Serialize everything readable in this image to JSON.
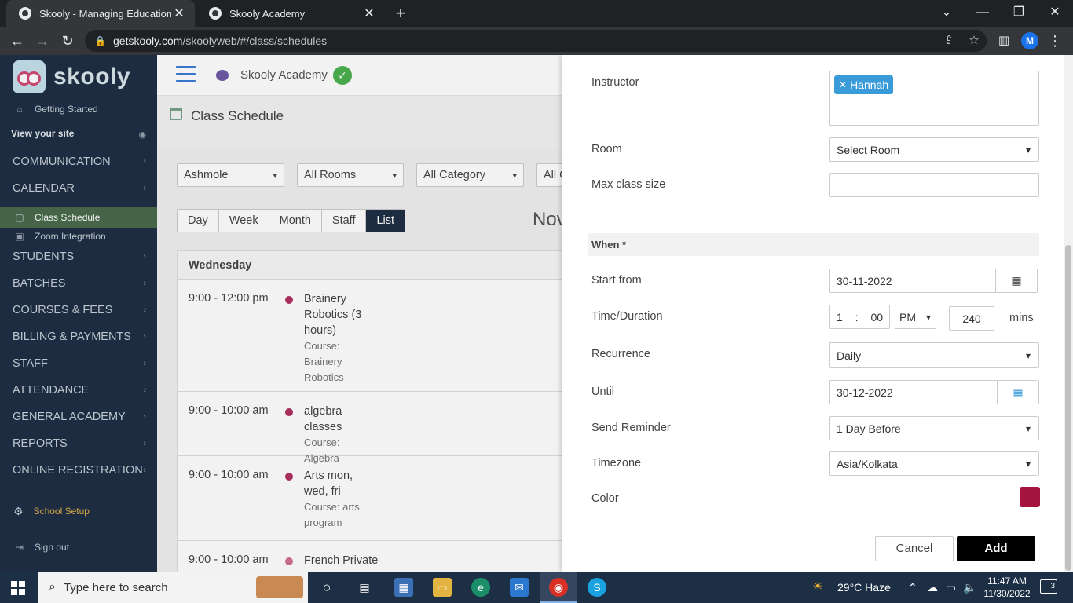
{
  "browser": {
    "tabs": [
      {
        "title": "Skooly - Managing Educational Institutes"
      },
      {
        "title": "Skooly Academy"
      }
    ],
    "url_host": "getskooly.com",
    "url_path": "/skoolyweb/#/class/schedules",
    "profile_initial": "M"
  },
  "sidebar": {
    "logo_text": "skooly",
    "getting_started": "Getting Started",
    "view_site": "View your site",
    "items": [
      {
        "label": "COMMUNICATION"
      },
      {
        "label": "CALENDAR"
      },
      {
        "label": "STUDENTS"
      },
      {
        "label": "BATCHES"
      },
      {
        "label": "COURSES & FEES"
      },
      {
        "label": "BILLING & PAYMENTS"
      },
      {
        "label": "STAFF"
      },
      {
        "label": "ATTENDANCE"
      },
      {
        "label": "GENERAL ACADEMY"
      },
      {
        "label": "REPORTS"
      },
      {
        "label": "ONLINE REGISTRATION"
      }
    ],
    "sub_items": [
      {
        "label": "Class Schedule"
      },
      {
        "label": "Zoom Integration"
      }
    ],
    "school_setup": "School Setup",
    "sign_out": "Sign out"
  },
  "topbar": {
    "org_name": "Skooly Academy"
  },
  "page": {
    "title": "Class Schedule",
    "filters": [
      "Ashmole",
      "All Rooms",
      "All Category",
      "All C"
    ],
    "view_tabs": [
      "Day",
      "Week",
      "Month",
      "Staff",
      "List"
    ],
    "selected_view": "List",
    "month_label": "Nov",
    "day_heading": "Wednesday",
    "events": [
      {
        "time": "9:00 - 12:00 pm",
        "name": "Brainery Robotics (3 hours)",
        "course": "Course: Brainery Robotics"
      },
      {
        "time": "9:00 - 10:00 am",
        "name": "algebra classes",
        "course": "Course: Algebra"
      },
      {
        "time": "9:00 - 10:00 am",
        "name": "Arts mon, wed, fri",
        "course": "Course: arts program"
      },
      {
        "time": "9:00 - 10:00 am",
        "name": "French Private",
        "course": ""
      }
    ]
  },
  "form": {
    "instructor_label": "Instructor",
    "instructor_tag": "Hannah",
    "room_label": "Room",
    "room_value": "Select Room",
    "max_size_label": "Max class size",
    "max_size_value": "",
    "when_heading": "When *",
    "start_label": "Start from",
    "start_value": "30-11-2022",
    "time_label": "Time/Duration",
    "hour": "1",
    "minute": "00",
    "ampm": "PM",
    "duration": "240",
    "mins_label": "mins",
    "recurrence_label": "Recurrence",
    "recurrence_value": "Daily",
    "until_label": "Until",
    "until_value": "30-12-2022",
    "reminder_label": "Send Reminder",
    "reminder_value": "1 Day Before",
    "timezone_label": "Timezone",
    "timezone_value": "Asia/Kolkata",
    "color_label": "Color",
    "color_value": "#a5133f",
    "cancel_label": "Cancel",
    "add_label": "Add"
  },
  "taskbar": {
    "search_placeholder": "Type here to search",
    "weather": "29°C  Haze",
    "time": "11:47 AM",
    "date": "11/30/2022",
    "notifications": "3"
  }
}
